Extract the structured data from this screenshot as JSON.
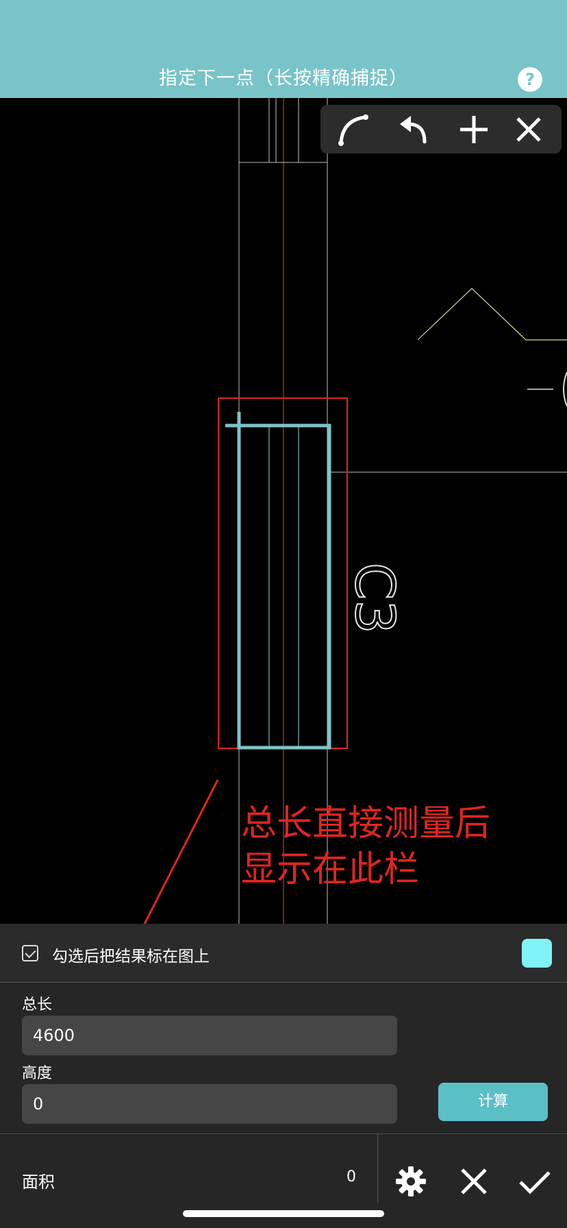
{
  "header": {
    "title": "指定下一点（长按精确捕捉）",
    "help_label": "?"
  },
  "toolbar": {
    "icons": [
      "arc-icon",
      "undo-icon",
      "plus-icon",
      "close-icon"
    ]
  },
  "drawing": {
    "label": "C3"
  },
  "annotation": {
    "line1": "总长直接测量后",
    "line2": "显示在此栏"
  },
  "panel": {
    "mark_on_drawing": {
      "label": "勾选后把结果标在图上",
      "checked": true,
      "color": "#7ff3f8"
    },
    "total_length": {
      "label": "总长",
      "value": "4600"
    },
    "height": {
      "label": "高度",
      "value": "0"
    },
    "calculate_label": "计算",
    "area": {
      "label": "面积",
      "value": "0"
    }
  },
  "colors": {
    "header_bg": "#79c4c8",
    "accent": "#5bbfc6",
    "annotation": "#e02520"
  }
}
